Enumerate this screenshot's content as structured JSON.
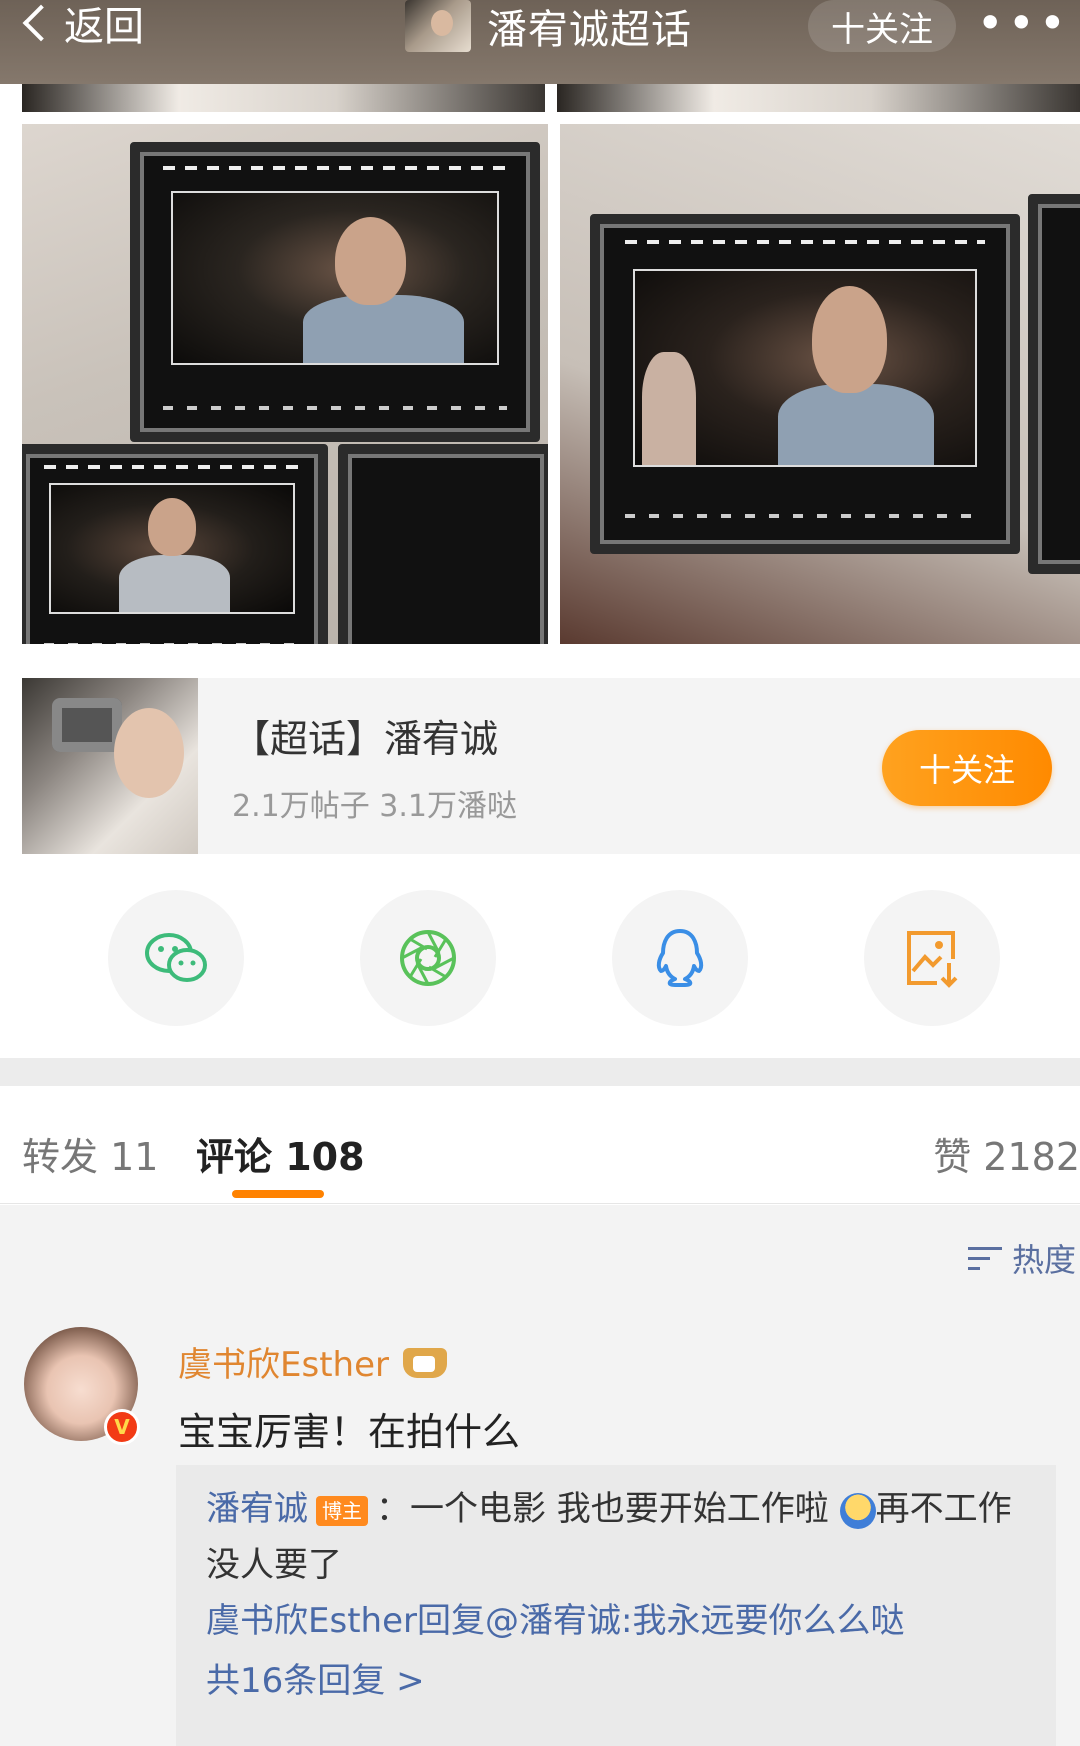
{
  "topbar": {
    "back_label": "返回",
    "title": "潘宥诚超话",
    "follow_label": "十关注",
    "more_label": "•••"
  },
  "topic_card": {
    "name": "【超话】潘宥诚",
    "stats": "2.1万帖子 3.1万潘哒",
    "follow_label": "十关注"
  },
  "share": {
    "items": [
      {
        "icon": "wechat-icon",
        "color": "#3dbb7a"
      },
      {
        "icon": "moments-icon",
        "color": "#59c25a"
      },
      {
        "icon": "qq-icon",
        "color": "#3a8ee6"
      },
      {
        "icon": "save-image-icon",
        "color": "#f29a2e"
      }
    ]
  },
  "tabs": {
    "repost": "转发 11",
    "comments": "评论 108",
    "likes": "赞 2182"
  },
  "sort": {
    "label": "热度"
  },
  "comment": {
    "author": "虞书欣Esther",
    "verified_badge": "V",
    "text": "宝宝厉害！在拍什么",
    "replies": [
      {
        "author": "潘宥诚",
        "tag": "博主",
        "text_before_emoji": "：一个电影 我也要开始工作啦",
        "text_after_emoji": "再不工作没人要了"
      },
      {
        "author": "虞书欣Esther",
        "text": "回复@潘宥诚:我永远要你么么哒"
      }
    ],
    "more_replies": "共16条回复 >"
  },
  "colors": {
    "accent": "#ff8200",
    "link": "#4a6aa8",
    "author_highlight": "#e08630"
  }
}
